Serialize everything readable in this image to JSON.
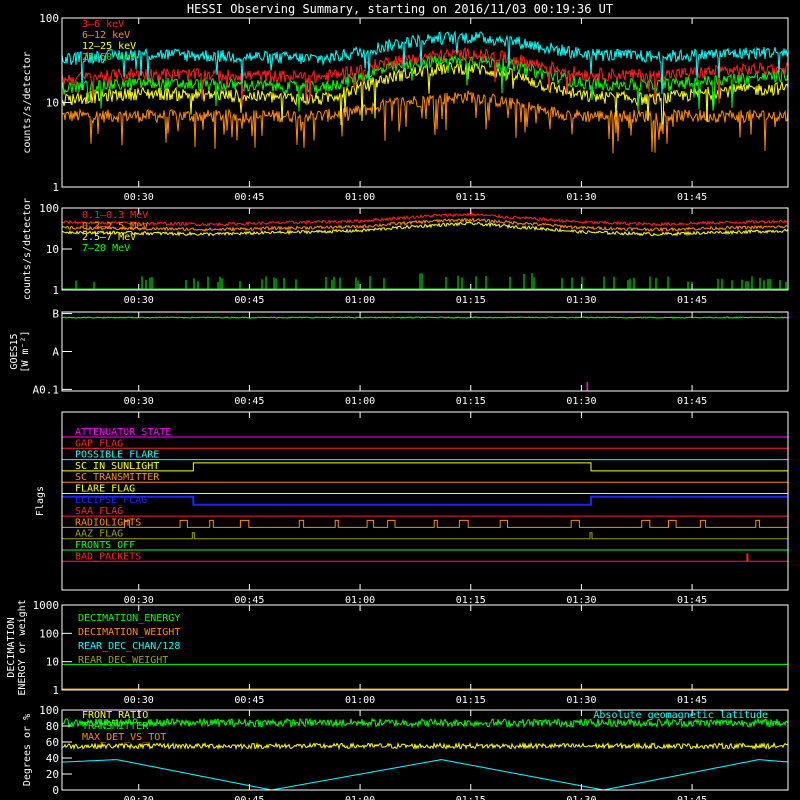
{
  "title": "HESSI Observing Summary, starting on 2016/11/03 00:19:36 UT",
  "time_ticks": [
    "00:30",
    "00:45",
    "01:00",
    "01:15",
    "01:30",
    "01:45"
  ],
  "time_ticks_min": [
    30,
    45,
    60,
    75,
    90,
    105
  ],
  "x_range_min": [
    19.6,
    118
  ],
  "colors": {
    "red": "#ff2020",
    "orange": "#ff8c00",
    "yellow": "#ffff00",
    "green": "#00ff00",
    "cyan": "#00ffff",
    "blue": "#2020ff",
    "magenta": "#ff00ff",
    "olive": "#a0a000"
  },
  "chart_data": [
    {
      "type": "line",
      "ylabel": "counts/s/detector",
      "yscale": "log",
      "ylim": [
        1,
        100
      ],
      "y_ticks": [
        "1",
        "10",
        "100"
      ],
      "legend": [
        "3–6 keV",
        "6–12 keV",
        "12–25 keV",
        "25–50 keV"
      ],
      "series": [
        {
          "name": "3–6 keV",
          "color": "cyan",
          "x": [
            20,
            30,
            45,
            55,
            60,
            65,
            70,
            75,
            80,
            85,
            90,
            100,
            110,
            118
          ],
          "y": [
            33,
            38,
            35,
            33,
            40,
            50,
            58,
            60,
            55,
            45,
            38,
            35,
            38,
            40
          ]
        },
        {
          "name": "6–12 keV",
          "color": "red",
          "x": [
            20,
            30,
            45,
            55,
            60,
            65,
            70,
            75,
            80,
            85,
            90,
            100,
            110,
            118
          ],
          "y": [
            19,
            22,
            21,
            20,
            25,
            32,
            36,
            38,
            34,
            27,
            22,
            21,
            24,
            26
          ]
        },
        {
          "name": "12–25 keV",
          "color": "green",
          "x": [
            20,
            30,
            45,
            55,
            60,
            65,
            70,
            75,
            80,
            85,
            90,
            100,
            110,
            118
          ],
          "y": [
            15,
            17,
            16,
            15,
            20,
            27,
            31,
            32,
            28,
            22,
            17,
            16,
            19,
            21
          ]
        },
        {
          "name": "25–50 keV",
          "color": "yellow",
          "x": [
            20,
            30,
            45,
            55,
            60,
            65,
            70,
            75,
            80,
            85,
            90,
            100,
            110,
            118
          ],
          "y": [
            11,
            13,
            12,
            11,
            15,
            21,
            25,
            26,
            22,
            16,
            12,
            11,
            14,
            15
          ]
        },
        {
          "name": "",
          "color": "orange",
          "x": [
            20,
            30,
            45,
            55,
            60,
            65,
            70,
            75,
            80,
            85,
            90,
            100,
            110,
            118
          ],
          "y": [
            7,
            7,
            7,
            7,
            8,
            10,
            11,
            12,
            10,
            8,
            7,
            7,
            7,
            7
          ]
        }
      ]
    },
    {
      "type": "line",
      "ylabel": "counts/s/detector",
      "yscale": "log",
      "ylim": [
        1,
        100
      ],
      "y_ticks": [
        "1",
        "10",
        "100"
      ],
      "legend": [
        "0.1–0.3 MeV",
        "0.3–2.5 MeV",
        "2.5–7 MeV",
        "7–20 MeV"
      ],
      "series": [
        {
          "name": "0.1–0.3 MeV",
          "color": "red",
          "x": [
            20,
            40,
            60,
            70,
            75,
            80,
            90,
            100,
            118
          ],
          "y": [
            45,
            40,
            48,
            65,
            70,
            60,
            45,
            40,
            48
          ]
        },
        {
          "name": "0.3–2.5 MeV",
          "color": "orange",
          "x": [
            20,
            40,
            60,
            70,
            75,
            80,
            90,
            100,
            118
          ],
          "y": [
            33,
            30,
            35,
            48,
            52,
            45,
            33,
            30,
            35
          ]
        },
        {
          "name": "2.5–7 MeV",
          "color": "yellow",
          "x": [
            20,
            40,
            60,
            70,
            75,
            80,
            90,
            100,
            118
          ],
          "y": [
            26,
            23,
            28,
            38,
            42,
            36,
            26,
            23,
            28
          ]
        },
        {
          "name": "7–20 MeV",
          "color": "green",
          "x": [
            20,
            40,
            60,
            70,
            75,
            80,
            90,
            100,
            118
          ],
          "y": [
            1.2,
            1.2,
            1.2,
            1.4,
            1.5,
            1.4,
            1.2,
            1.2,
            1.2
          ]
        }
      ]
    },
    {
      "type": "line",
      "ylabel": "GOES15",
      "ylabel2": "[W m⁻²]",
      "y_ticks": [
        "A0.1",
        "A",
        "B"
      ],
      "series": [
        {
          "name": "",
          "color": "green",
          "x": [
            20,
            118
          ],
          "y": [
            0.93,
            0.93
          ]
        }
      ],
      "spike": {
        "x": 90.8,
        "color": "magenta"
      }
    },
    {
      "type": "table",
      "ylabel": "Flags",
      "flags": [
        {
          "name": "ATTENUATOR_STATE",
          "color": "magenta"
        },
        {
          "name": "GAP_FLAG",
          "color": "red"
        },
        {
          "name": "POSSIBLE_FLARE",
          "color": "cyan"
        },
        {
          "name": "SC_IN_SUNLIGHT",
          "color": "yellow"
        },
        {
          "name": "SC_TRANSMITTER",
          "color": "orange"
        },
        {
          "name": "FLARE_FLAG",
          "color": "yellow"
        },
        {
          "name": "ECLIPSE_FLAG",
          "color": "blue"
        },
        {
          "name": "SAA_FLAG",
          "color": "red"
        },
        {
          "name": "RADIOLIGHTS",
          "color": "orange"
        },
        {
          "name": "AAZ_FLAG",
          "color": "olive"
        },
        {
          "name": "FRONTS_OFF",
          "color": "green"
        },
        {
          "name": "BAD_PACKETS",
          "color": "red"
        }
      ]
    },
    {
      "type": "line",
      "ylabel": "DECIMATION",
      "ylabel2": "ENERGY or weight",
      "yscale": "log",
      "ylim": [
        1,
        1000
      ],
      "y_ticks": [
        "1",
        "10",
        "100",
        "1000"
      ],
      "legend": [
        "DECIMATION_ENERGY",
        "DECIMATION_WEIGHT",
        "REAR_DEC_CHAN/128",
        "REAR_DEC_WEIGHT"
      ],
      "series": [
        {
          "name": "DECIMATION_ENERGY",
          "color": "green",
          "x": [
            20,
            118
          ],
          "y": [
            8,
            8
          ]
        },
        {
          "name": "DECIMATION_WEIGHT",
          "color": "orange",
          "x": [
            20,
            118
          ],
          "y": [
            1,
            1
          ]
        }
      ]
    },
    {
      "type": "line",
      "ylabel": "Degrees or %",
      "ylim": [
        0,
        100
      ],
      "y_ticks": [
        "0",
        "20",
        "40",
        "60",
        "80",
        "100"
      ],
      "legend": [
        "FRONT_RATIO",
        "TRANSMITTER",
        "MAX_DET_VS_TOT"
      ],
      "legend_right": "Absolute geomagnetic latitude",
      "series": [
        {
          "name": "FRONT_RATIO",
          "color": "green",
          "x": [
            20,
            118
          ],
          "y": [
            84,
            84
          ]
        },
        {
          "name": "MAX_DET_VS_TOT",
          "color": "yellow",
          "x": [
            20,
            118
          ],
          "y": [
            55,
            55
          ]
        },
        {
          "name": "Absolute geomagnetic latitude",
          "color": "cyan",
          "x": [
            20,
            27,
            48,
            71,
            93,
            114,
            118
          ],
          "y": [
            35,
            38,
            0,
            38,
            0,
            38,
            35
          ]
        }
      ]
    }
  ]
}
